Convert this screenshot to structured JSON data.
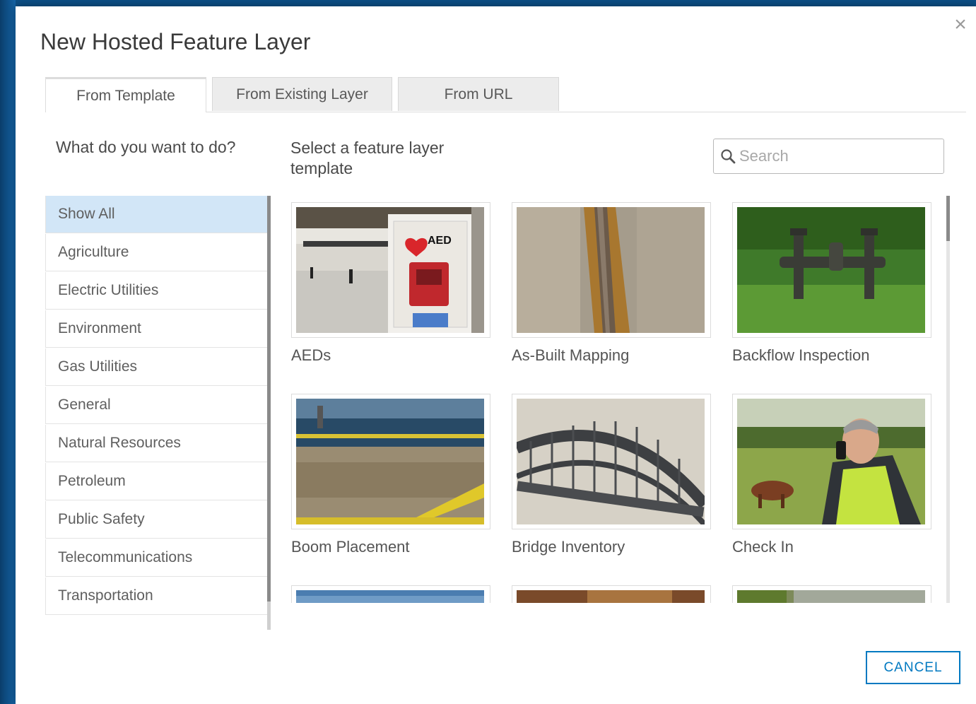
{
  "dialog": {
    "title": "New Hosted Feature Layer",
    "close_symbol": "×"
  },
  "tabs": [
    {
      "label": "From Template",
      "active": true
    },
    {
      "label": "From Existing Layer",
      "active": false
    },
    {
      "label": "From URL",
      "active": false
    }
  ],
  "left_panel": {
    "question": "What do you want to do?",
    "categories": [
      {
        "label": "Show All",
        "selected": true
      },
      {
        "label": "Agriculture"
      },
      {
        "label": "Electric Utilities"
      },
      {
        "label": "Environment"
      },
      {
        "label": "Gas Utilities"
      },
      {
        "label": "General"
      },
      {
        "label": "Natural Resources"
      },
      {
        "label": "Petroleum"
      },
      {
        "label": "Public Safety"
      },
      {
        "label": "Telecommunications"
      },
      {
        "label": "Transportation"
      }
    ]
  },
  "right_panel": {
    "heading": "Select a feature layer template",
    "search": {
      "placeholder": "Search",
      "value": "",
      "icon": "search-icon"
    },
    "templates": [
      {
        "label": "AEDs",
        "image": "aed-station-photo"
      },
      {
        "label": "As-Built Mapping",
        "image": "pipe-trench-photo"
      },
      {
        "label": "Backflow Inspection",
        "image": "backflow-valve-photo"
      },
      {
        "label": "Boom Placement",
        "image": "oil-boom-beach-photo"
      },
      {
        "label": "Bridge Inventory",
        "image": "arch-bridge-photo"
      },
      {
        "label": "Check In",
        "image": "worker-phone-field-photo"
      },
      {
        "label": "",
        "image": "sky-photo-partial"
      },
      {
        "label": "",
        "image": "brown-photo-partial"
      },
      {
        "label": "",
        "image": "vegetation-photo-partial"
      }
    ]
  },
  "footer": {
    "cancel_label": "CANCEL"
  },
  "colors": {
    "accent": "#0079c1",
    "selected_bg": "#d2e6f7"
  }
}
